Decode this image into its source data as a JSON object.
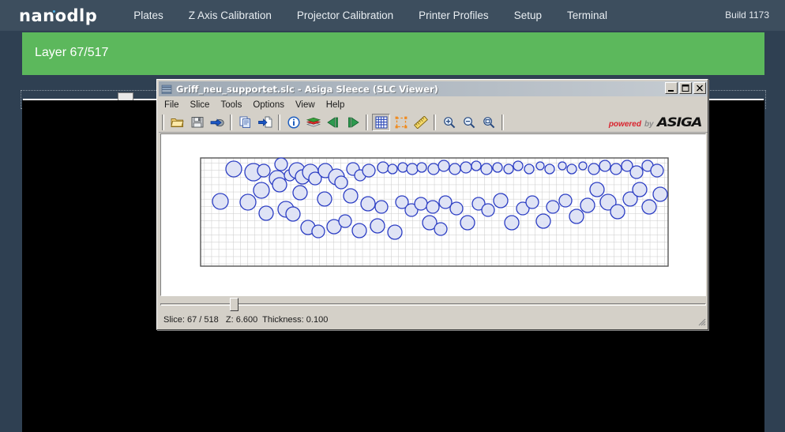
{
  "nav": {
    "logo": "nanodlp",
    "items": [
      {
        "label": "Plates"
      },
      {
        "label": "Z Axis Calibration"
      },
      {
        "label": "Projector Calibration"
      },
      {
        "label": "Printer Profiles"
      },
      {
        "label": "Setup"
      },
      {
        "label": "Terminal"
      }
    ],
    "build": "Build 1173"
  },
  "layer_bar": {
    "text": "Layer 67/517",
    "color": "#5cb85c"
  },
  "layer_slider": {
    "value": 67,
    "min": 1,
    "max": 517
  },
  "viewer": {
    "title": "Griff_neu_supportet.slc - Asiga Sleece (SLC Viewer)",
    "title_icon": "layers-stack-icon",
    "window_buttons": [
      {
        "name": "minimize",
        "glyph": "_"
      },
      {
        "name": "maximize",
        "glyph": "☐"
      },
      {
        "name": "close",
        "glyph": "✕"
      }
    ],
    "menu": [
      {
        "label": "File"
      },
      {
        "label": "Slice"
      },
      {
        "label": "Tools"
      },
      {
        "label": "Options"
      },
      {
        "label": "View"
      },
      {
        "label": "Help"
      }
    ],
    "toolbar": [
      {
        "name": "open-folder-icon",
        "group": 1,
        "pressed": false
      },
      {
        "name": "save-disk-icon",
        "group": 1,
        "pressed": false
      },
      {
        "name": "export-icon",
        "group": 1,
        "pressed": false
      },
      {
        "name": "copy-icon",
        "group": 2,
        "pressed": false
      },
      {
        "name": "paste-to-file-icon",
        "group": 2,
        "pressed": false
      },
      {
        "name": "info-icon",
        "group": 3,
        "pressed": false
      },
      {
        "name": "layers-icon",
        "group": 3,
        "pressed": false
      },
      {
        "name": "previous-slice-icon",
        "group": 3,
        "pressed": false
      },
      {
        "name": "next-slice-icon",
        "group": 3,
        "pressed": false
      },
      {
        "name": "grid-toggle-icon",
        "group": 4,
        "pressed": true
      },
      {
        "name": "bounding-box-icon",
        "group": 4,
        "pressed": false
      },
      {
        "name": "measure-ruler-icon",
        "group": 4,
        "pressed": false
      },
      {
        "name": "zoom-in-icon",
        "group": 5,
        "pressed": false
      },
      {
        "name": "zoom-out-icon",
        "group": 5,
        "pressed": false
      },
      {
        "name": "zoom-fit-icon",
        "group": 5,
        "pressed": false
      }
    ],
    "branding": {
      "powered": "powered",
      "by": "by",
      "name": "ASIGA"
    },
    "slice_slider": {
      "value": 67,
      "min": 1,
      "max": 518
    },
    "status": "Slice: 67 / 518   Z: 6.600  Thickness: 0.100",
    "status_parts": {
      "slice": "Slice: 67 / 518",
      "z": "Z: 6.600",
      "thickness": "Thickness: 0.100"
    }
  },
  "slice_view": {
    "grid_color": "#c9c9c9",
    "outline_color": "#2c3ec4",
    "fill_color": "#dfe3f5",
    "border_color": "#555555"
  },
  "projector_preview": {
    "background": "#000000",
    "dot_color": "#ffffff"
  }
}
